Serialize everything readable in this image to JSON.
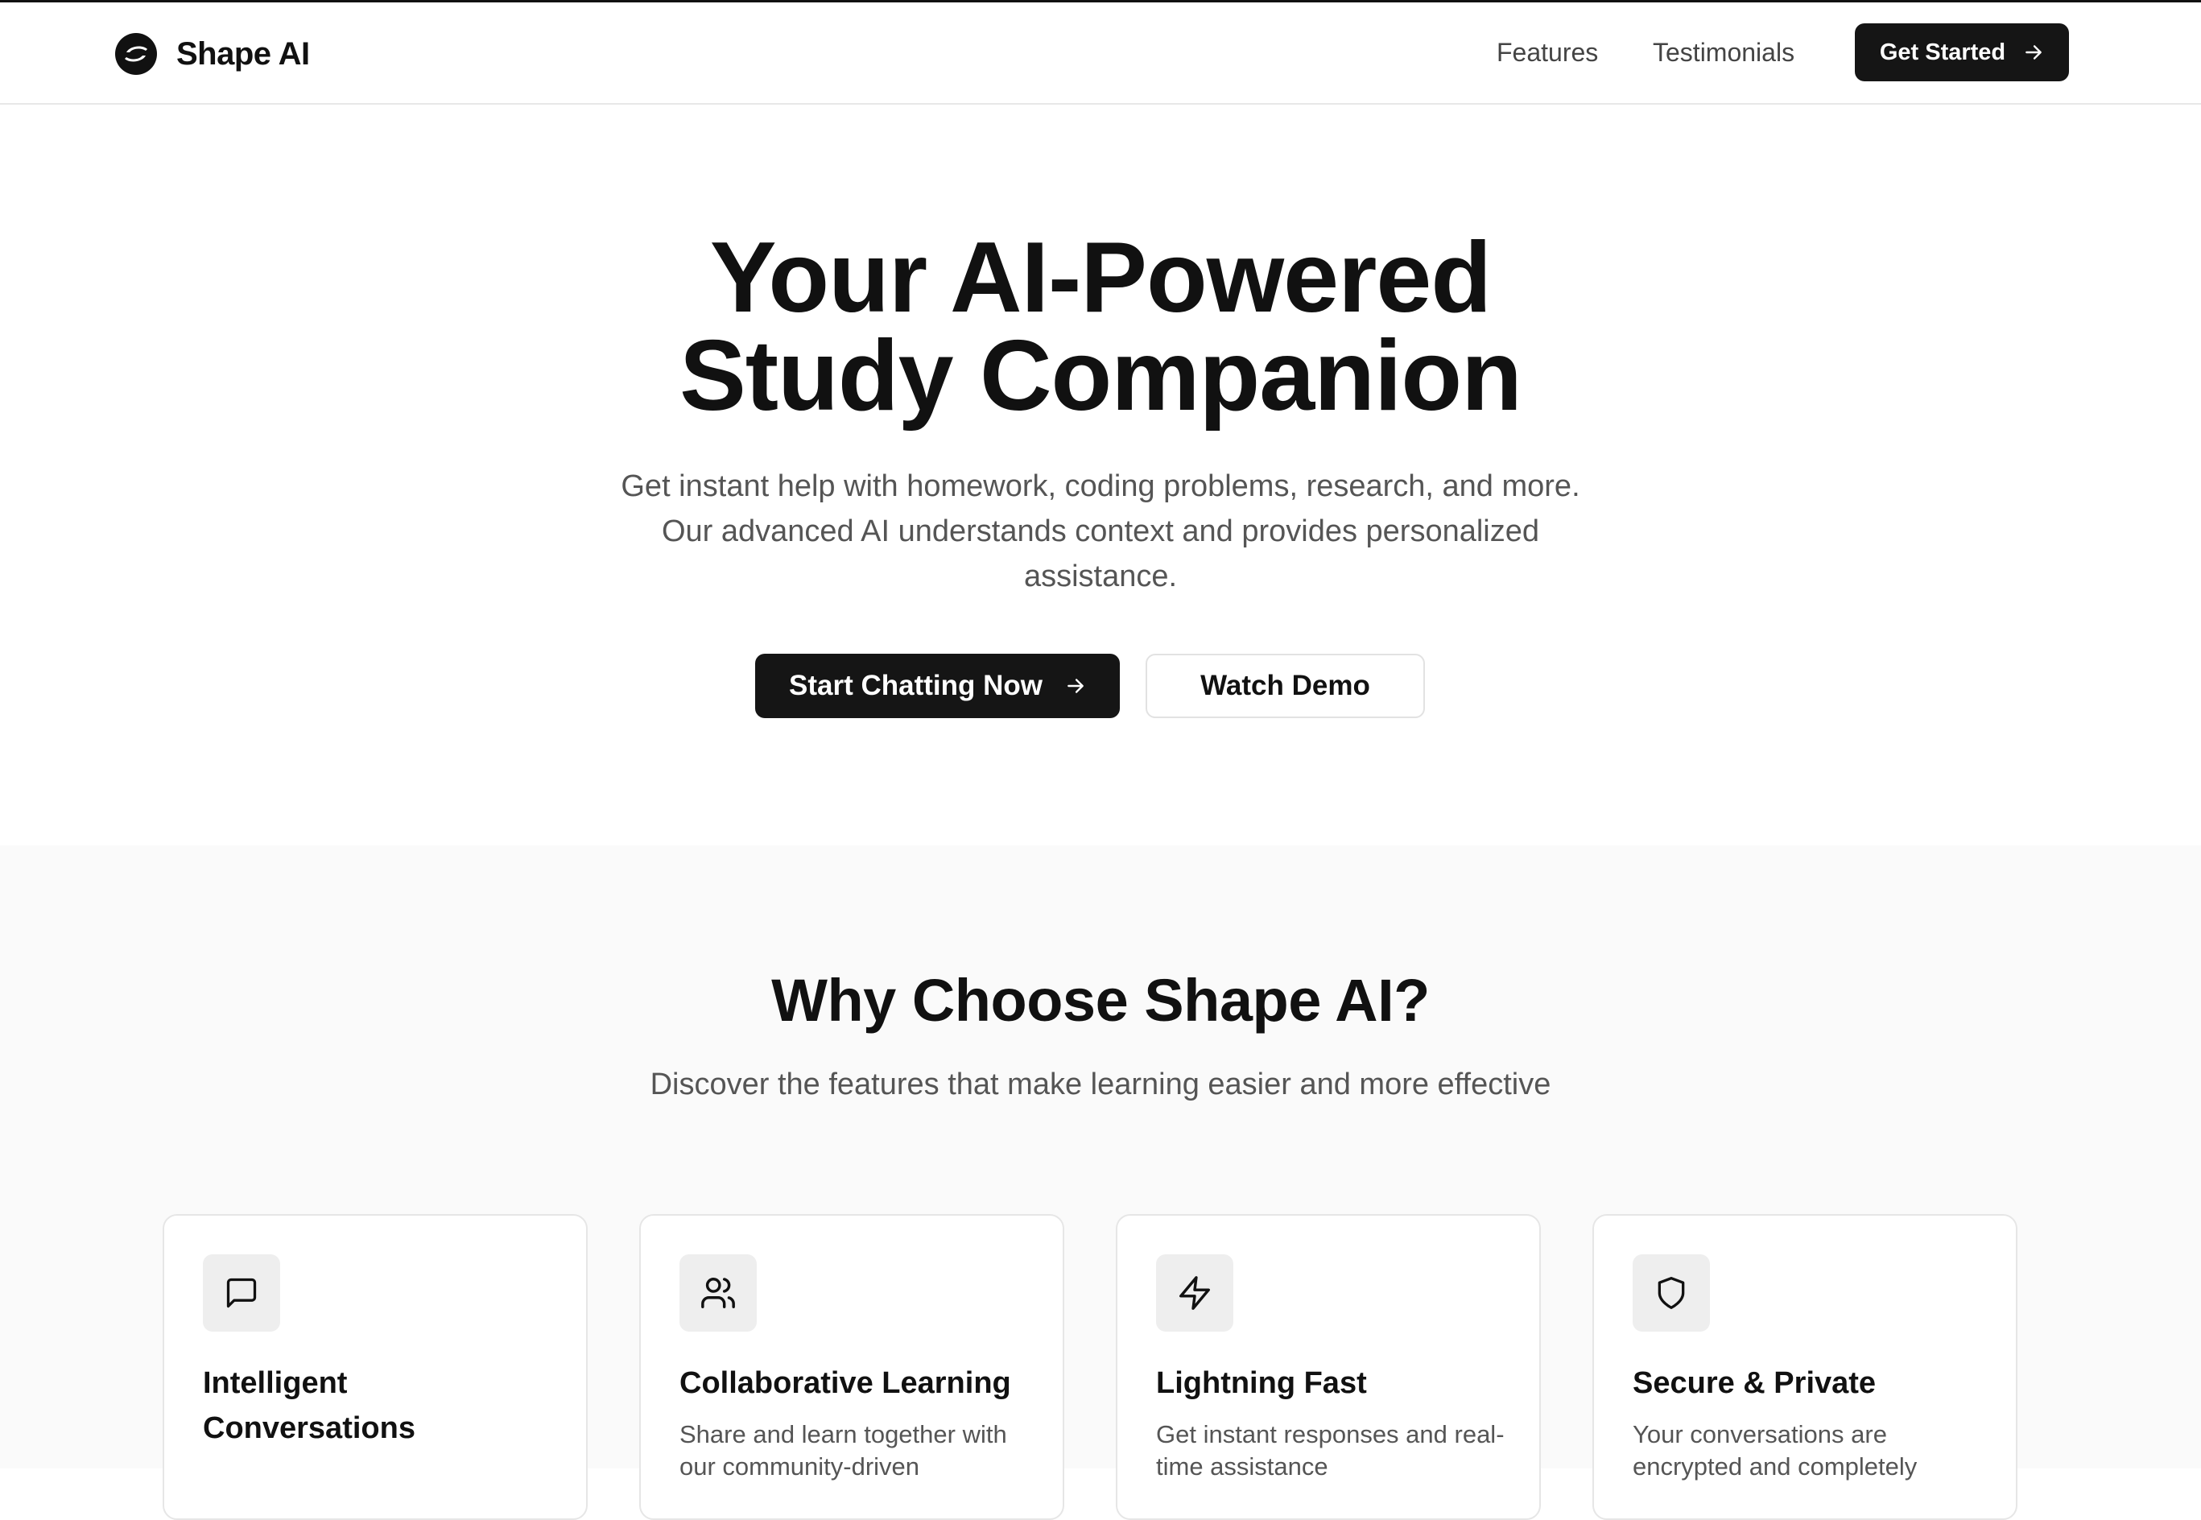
{
  "header": {
    "brand": "Shape AI",
    "nav": [
      "Features",
      "Testimonials"
    ],
    "cta_label": "Get Started"
  },
  "hero": {
    "title_line1": "Your AI-Powered",
    "title_line2": "Study Companion",
    "subtitle": "Get instant help with homework, coding problems, research, and more. Our advanced AI understands context and provides personalized assistance.",
    "primary_button": "Start Chatting Now",
    "secondary_button": "Watch Demo"
  },
  "why": {
    "title": "Why Choose Shape AI?",
    "subtitle": "Discover the features that make learning easier and more effective",
    "cards": [
      {
        "icon": "message-square-icon",
        "title": "Intelligent Conversations",
        "description": ""
      },
      {
        "icon": "users-icon",
        "title": "Collaborative Learning",
        "description": "Share and learn together with our community-driven"
      },
      {
        "icon": "zap-icon",
        "title": "Lightning Fast",
        "description": "Get instant responses and real-time assistance"
      },
      {
        "icon": "shield-icon",
        "title": "Secure & Private",
        "description": "Your conversations are encrypted and completely"
      }
    ]
  },
  "colors": {
    "primary": "#151515",
    "text": "#111111",
    "muted": "#555555",
    "section_bg": "#fafafa",
    "icon_bg": "#eeeeee",
    "border": "#e6e6e6"
  }
}
